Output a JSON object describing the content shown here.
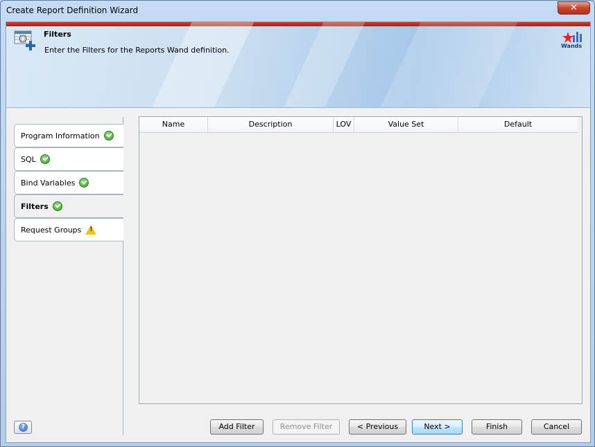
{
  "window": {
    "title": "Create Report Definition Wizard",
    "close_label": "✕"
  },
  "banner": {
    "title": "Filters",
    "subtitle": "Enter the Filters for the Reports Wand definition.",
    "logo_text": "Wands"
  },
  "nav": {
    "items": [
      {
        "label": "Program Information",
        "status": "complete"
      },
      {
        "label": "SQL",
        "status": "complete"
      },
      {
        "label": "Bind Variables",
        "status": "complete"
      },
      {
        "label": "Filters",
        "status": "complete",
        "active": true
      },
      {
        "label": "Request Groups",
        "status": "warning"
      }
    ]
  },
  "grid": {
    "columns": [
      "Name",
      "Description",
      "LOV",
      "Value Set",
      "Default"
    ],
    "rows": []
  },
  "help": {
    "label": "?"
  },
  "buttons": {
    "add_filter": "Add Filter",
    "remove_filter": "Remove Filter",
    "previous": "< Previous",
    "next": "Next >",
    "finish": "Finish",
    "cancel": "Cancel"
  },
  "colors": {
    "accent_red": "#c9442d",
    "banner_blue": "#a5c7e8",
    "check_green": "#3e9f2d",
    "warning_yellow": "#f2c21a"
  }
}
